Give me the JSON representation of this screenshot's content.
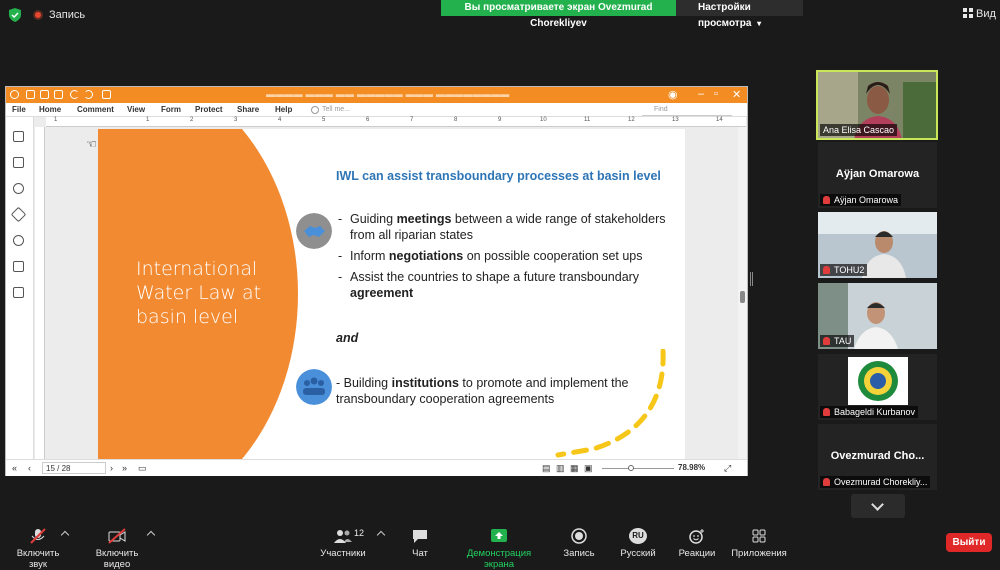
{
  "top": {
    "record_label": "Запись",
    "share_banner": "Вы просматриваете экран Ovezmurad Chorekliyev",
    "view_settings": "Настройки просмотра",
    "view_button": "Вид"
  },
  "app": {
    "menu": [
      "File",
      "Home",
      "Comment",
      "View",
      "Form",
      "Protect",
      "Share",
      "Help"
    ],
    "tell_me": "Tell me...",
    "find": "Find",
    "ruler_h": [
      "1",
      "1",
      "2",
      "3",
      "4",
      "5",
      "6",
      "7",
      "8",
      "9",
      "10",
      "11",
      "12",
      "13",
      "14"
    ],
    "page_indicator": "15 / 28",
    "zoom": "78.98%"
  },
  "slide": {
    "left_title": "International Water Law at basin level",
    "heading": "IWL can assist transboundary processes at basin level",
    "bullets": [
      {
        "pre": "Guiding ",
        "bold": "meetings",
        "post": " between a wide range of stakeholders from all riparian states"
      },
      {
        "pre": "Inform ",
        "bold": "negotiations",
        "post": " on possible cooperation set ups"
      },
      {
        "pre": "Assist the countries to shape a future transboundary ",
        "bold": "agreement",
        "post": ""
      }
    ],
    "and": "and",
    "bullet_b": {
      "pre": "- Building ",
      "bold": "institutions",
      "post": " to promote and implement the transboundary cooperation agreements"
    },
    "colors": {
      "orange": "#f28a32",
      "heading_blue": "#2e75b6",
      "icon_blue": "#4a8fd9",
      "icon_gray": "#8f8f8f",
      "accent_yellow": "#f6c619"
    }
  },
  "participants": [
    {
      "name": "Ana Elisa Cascao",
      "type": "video",
      "active": true
    },
    {
      "name": "Aÿjan Omarowa",
      "label": "Aÿjan Omarowa",
      "type": "name",
      "muted": true
    },
    {
      "name": "TOHU2",
      "label": "TOHU2",
      "type": "video",
      "muted": true
    },
    {
      "name": "TAU",
      "label": "TAU",
      "type": "video",
      "muted": true
    },
    {
      "name": "Babageldi Kurbanov",
      "label": "Babageldi Kurbanov",
      "type": "logo",
      "muted": true
    },
    {
      "name": "Ovezmurad  Cho...",
      "label": "Ovezmurad Chorekliy...",
      "type": "name",
      "muted": true
    }
  ],
  "toolbar": {
    "unmute": "Включить звук",
    "start_video": "Включить видео",
    "participants": "Участники",
    "participants_count": "12",
    "chat": "Чат",
    "share_screen": "Демонстрация экрана",
    "record": "Запись",
    "language": "Русский",
    "language_badge": "RU",
    "reactions": "Реакции",
    "apps": "Приложения",
    "leave": "Выйти"
  }
}
